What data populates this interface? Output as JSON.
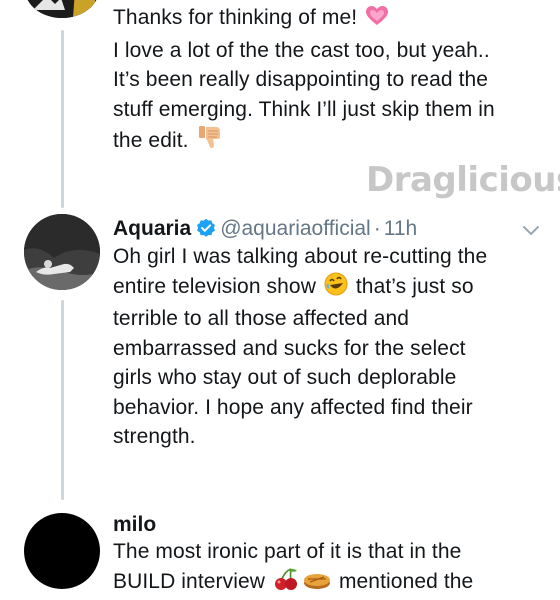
{
  "tweet1": {
    "lines": [
      "Thanks for thinking of me!",
      "I love a lot of the the cast too, but yeah..",
      "It’s been really disappointing to read the",
      "stuff emerging. Think I’ll just skip them in",
      "the edit."
    ],
    "emoji_heart": "sparkling-heart-icon",
    "emoji_thumbs": "thumbs-down-icon"
  },
  "watermark": {
    "text": "Draglicious"
  },
  "tweet2": {
    "name": "Aquaria",
    "handle": "@aquariaofficial",
    "separator": "·",
    "time": "11h",
    "lines": [
      "Oh girl I was talking about re-cutting the",
      "entire television show",
      "that’s just so",
      "terrible to all those affected and",
      "embarrassed and sucks for the select",
      "girls who stay out of such deplorable",
      "behavior. I hope any affected find their",
      "strength."
    ],
    "emoji_laugh": "rolling-on-floor-laughing-icon"
  },
  "tweet3": {
    "name": "milo",
    "lines": [
      "The most ironic part of it is that in the",
      "BUILD interview",
      "mentioned the"
    ],
    "emoji_cherries": "cherries-icon",
    "emoji_pie": "pie-icon"
  },
  "colors": {
    "thread_line": "#ccd6dd",
    "handle": "#657786",
    "verified": "#1da1f2",
    "text": "#14171a"
  }
}
